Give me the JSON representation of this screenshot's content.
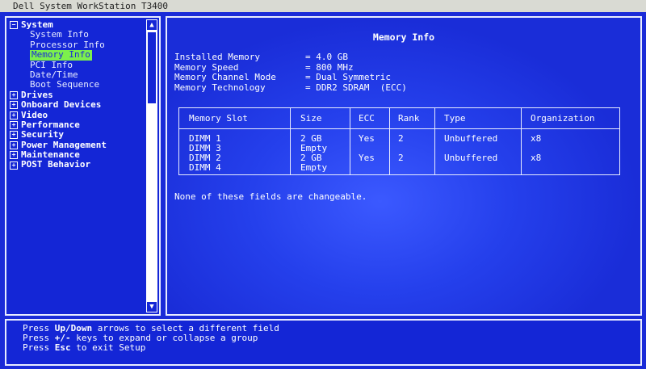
{
  "window_title": "Dell System WorkStation T3400",
  "tree": [
    {
      "label": "System",
      "type": "top",
      "expander": "−"
    },
    {
      "label": "System Info",
      "type": "child"
    },
    {
      "label": "Processor Info",
      "type": "child"
    },
    {
      "label": "Memory Info",
      "type": "child",
      "selected": true
    },
    {
      "label": "PCI Info",
      "type": "child"
    },
    {
      "label": "Date/Time",
      "type": "child"
    },
    {
      "label": "Boot Sequence",
      "type": "child"
    },
    {
      "label": "Drives",
      "type": "top",
      "expander": "+"
    },
    {
      "label": "Onboard Devices",
      "type": "top",
      "expander": "+"
    },
    {
      "label": "Video",
      "type": "top",
      "expander": "+"
    },
    {
      "label": "Performance",
      "type": "top",
      "expander": "+"
    },
    {
      "label": "Security",
      "type": "top",
      "expander": "+"
    },
    {
      "label": "Power Management",
      "type": "top",
      "expander": "+"
    },
    {
      "label": "Maintenance",
      "type": "top",
      "expander": "+"
    },
    {
      "label": "POST Behavior",
      "type": "top",
      "expander": "+"
    }
  ],
  "scroll": {
    "up": "▲",
    "down": "▼"
  },
  "main": {
    "title": "Memory Info",
    "info": [
      {
        "key": "Installed Memory",
        "value": "= 4.0 GB"
      },
      {
        "key": "Memory Speed",
        "value": "= 800 MHz"
      },
      {
        "key": "Memory Channel Mode",
        "value": "= Dual Symmetric"
      },
      {
        "key": "Memory Technology",
        "value": "= DDR2 SDRAM  (ECC)"
      }
    ],
    "table": {
      "headers": [
        "Memory Slot",
        "Size",
        "ECC",
        "Rank",
        "Type",
        "Organization"
      ],
      "rows": [
        {
          "slot": "DIMM 1",
          "size": "2 GB",
          "ecc": "Yes",
          "rank": "2",
          "type": "Unbuffered",
          "org": "x8"
        },
        {
          "slot": "DIMM 3",
          "size": "Empty",
          "ecc": "",
          "rank": "",
          "type": "",
          "org": ""
        },
        {
          "slot": "DIMM 2",
          "size": "2 GB",
          "ecc": "Yes",
          "rank": "2",
          "type": "Unbuffered",
          "org": "x8"
        },
        {
          "slot": "DIMM 4",
          "size": "Empty",
          "ecc": "",
          "rank": "",
          "type": "",
          "org": ""
        }
      ]
    },
    "note": "None of these fields are changeable."
  },
  "help": [
    {
      "pre": "Press ",
      "key": "Up/Down",
      "post": " arrows to select a different field"
    },
    {
      "pre": "Press ",
      "key": "+/-",
      "post": " keys to expand or collapse a group"
    },
    {
      "pre": "Press ",
      "key": "Esc",
      "post": " to exit Setup"
    }
  ],
  "colors": {
    "background": "#1a2bd8",
    "selection": "#7cf04c",
    "titlebar": "#d9dad3"
  }
}
